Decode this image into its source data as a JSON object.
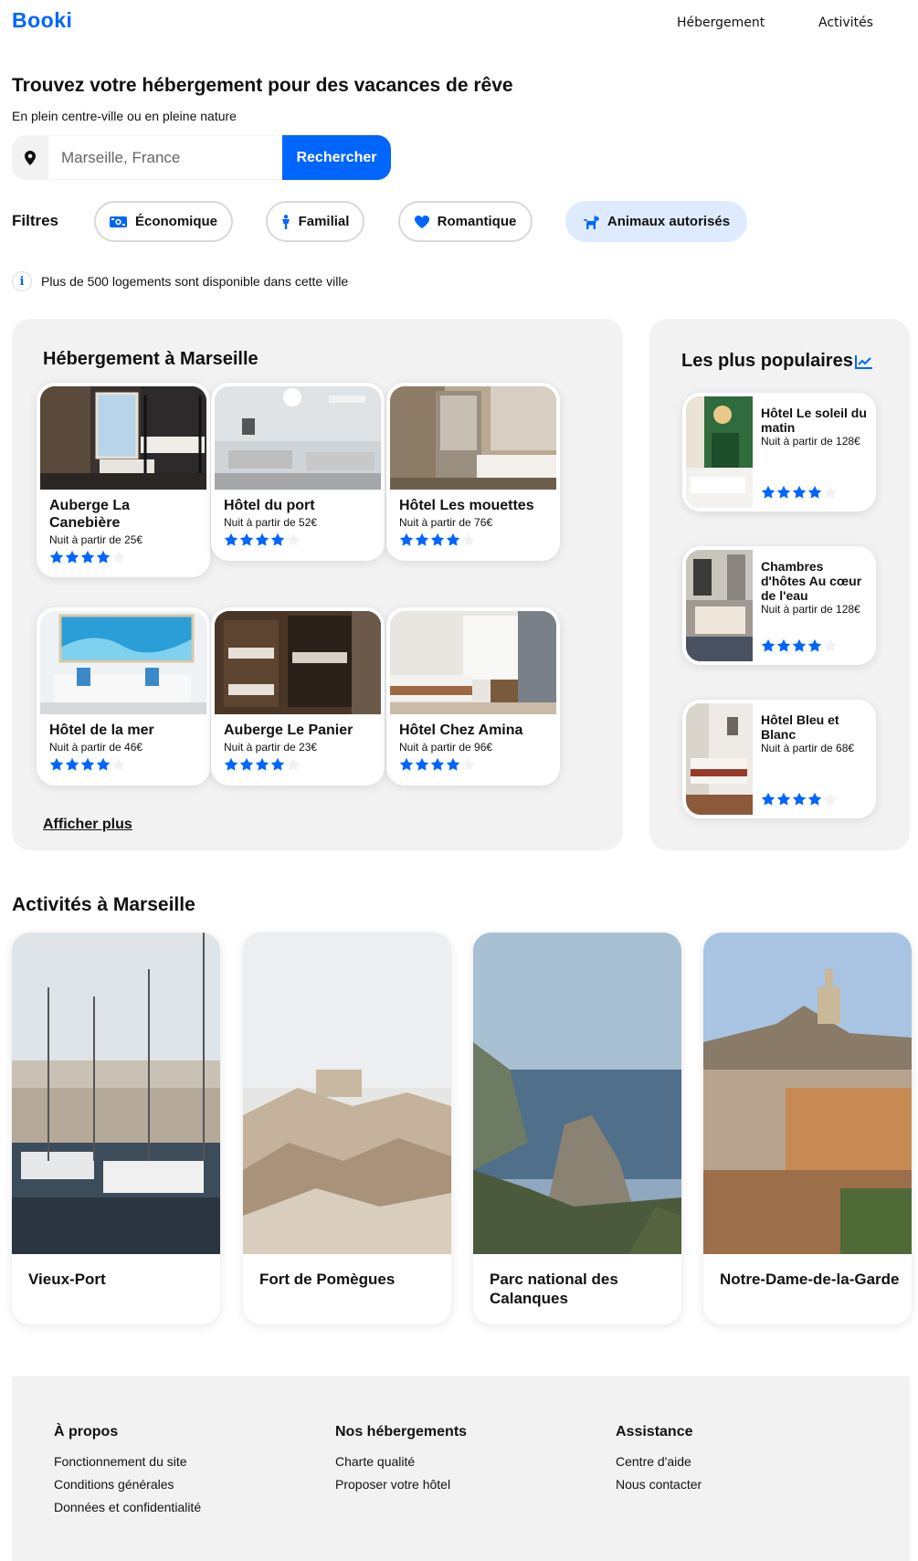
{
  "header": {
    "logo": "Booki",
    "nav": [
      "Hébergement",
      "Activités"
    ]
  },
  "hero": {
    "title": "Trouvez votre hébergement pour des vacances de rêve",
    "subtitle": "En plein centre-ville ou en pleine nature"
  },
  "search": {
    "placeholder": "Marseille, France",
    "button": "Rechercher"
  },
  "filters": {
    "label": "Filtres",
    "items": [
      "Économique",
      "Familial",
      "Romantique",
      "Animaux autorisés"
    ],
    "active": "Animaux autorisés"
  },
  "info": "Plus de 500 logements sont disponible dans cette ville",
  "lodging": {
    "title": "Hébergement à Marseille",
    "show_more": "Afficher plus",
    "cards": [
      {
        "name": "Auberge La Canebière",
        "price": "Nuit à partir de 25€",
        "rating": 4
      },
      {
        "name": "Hôtel du port",
        "price": "Nuit à partir de 52€",
        "rating": 4
      },
      {
        "name": "Hôtel Les mouettes",
        "price": "Nuit à partir de 76€",
        "rating": 4
      },
      {
        "name": "Hôtel de la mer",
        "price": "Nuit à partir de 46€",
        "rating": 4
      },
      {
        "name": "Auberge Le Panier",
        "price": "Nuit à partir de 23€",
        "rating": 4
      },
      {
        "name": "Hôtel Chez Amina",
        "price": "Nuit à partir de 96€",
        "rating": 4
      }
    ]
  },
  "popular": {
    "title": "Les plus populaires",
    "cards": [
      {
        "name": "Hôtel Le soleil du matin",
        "price": "Nuit à partir de 128€",
        "rating": 4
      },
      {
        "name": "Chambres d'hôtes Au cœur de l'eau",
        "price": "Nuit à partir de 128€",
        "rating": 4
      },
      {
        "name": "Hôtel Bleu et Blanc",
        "price": "Nuit à partir de 68€",
        "rating": 4
      }
    ]
  },
  "activities": {
    "title": "Activités à Marseille",
    "cards": [
      "Vieux-Port",
      "Fort de Pomègues",
      "Parc national des Calanques",
      "Notre-Dame-de-la-Garde"
    ]
  },
  "footer": {
    "columns": [
      {
        "title": "À propos",
        "links": [
          "Fonctionnement du site",
          "Conditions générales",
          "Données et confidentialité"
        ]
      },
      {
        "title": "Nos hébergements",
        "links": [
          "Charte qualité",
          "Proposer votre hôtel"
        ]
      },
      {
        "title": "Assistance",
        "links": [
          "Centre d'aide",
          "Nous contacter"
        ]
      }
    ]
  },
  "colors": {
    "accent": "#0065FC",
    "panel": "#F2F2F2",
    "active_filter": "#DEEBFF",
    "star_empty": "#F2F2F2"
  },
  "icons": {
    "search": "map-pin-icon",
    "filters": [
      "money-icon",
      "child-icon",
      "heart-icon",
      "dog-icon"
    ],
    "info": "info-icon",
    "popular": "chart-line-icon"
  }
}
